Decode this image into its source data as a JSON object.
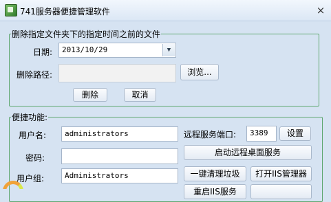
{
  "window": {
    "title": "741服务器便捷管理软件",
    "close_glyph": "×"
  },
  "delete_group": {
    "legend": "删除指定文件夹下的指定时间之前的文件",
    "date_label": "日期:",
    "date_value": "2013/10/29",
    "path_label": "删除路径:",
    "path_value": "",
    "browse_label": "浏览...",
    "delete_label": "删除",
    "cancel_label": "取消"
  },
  "quick_group": {
    "legend": "便捷功能:",
    "username_label": "用户名:",
    "username_value": "administrators",
    "password_label": "密码:",
    "password_value": "",
    "usergroup_label": "用户组:",
    "usergroup_value": "Administrators",
    "remote_port_label": "远程服务端口:",
    "remote_port_value": "3389",
    "settings_label": "设置",
    "start_remote_label": "启动远程桌面服务",
    "cleanup_label": "一键清理垃圾",
    "iis_manager_label": "打开IIS管理器",
    "restart_iis_label": "重启IIS服务"
  }
}
